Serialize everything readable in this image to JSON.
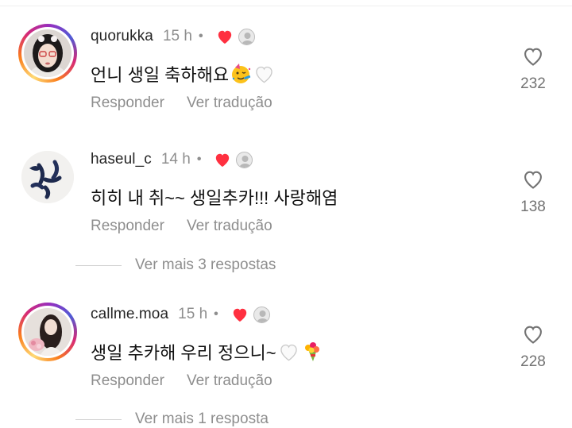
{
  "comments": [
    {
      "username": "quorukka",
      "time": "15 h",
      "text": "언니 생일 축하해요",
      "reply_label": "Responder",
      "translate_label": "Ver tradução",
      "likes": "232",
      "avatar_ring": true
    },
    {
      "username": "haseul_c",
      "time": "14 h",
      "text": "히히 내 취~~ 생일추카!!! 사랑해염",
      "reply_label": "Responder",
      "translate_label": "Ver tradução",
      "likes": "138",
      "avatar_ring": false,
      "more_replies": "Ver mais 3 respostas"
    },
    {
      "username": "callme.moa",
      "time": "15 h",
      "text": "생일 추카해 우리 정으니~",
      "reply_label": "Responder",
      "translate_label": "Ver tradução",
      "likes": "228",
      "avatar_ring": true,
      "more_replies": "Ver mais 1 resposta"
    }
  ],
  "icons": {
    "like": "heart-outline-icon",
    "creator_liked": "heart-filled-icon",
    "creator_heart_color": "#ff3040"
  }
}
